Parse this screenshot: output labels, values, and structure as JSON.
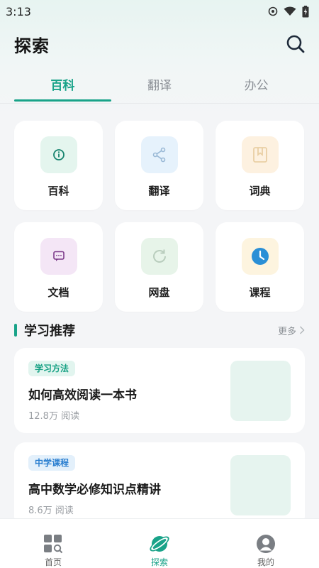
{
  "status_bar": {
    "time": "3:13",
    "icons": [
      "settings-gear-icon",
      "wifi-icon",
      "battery-charging-icon"
    ]
  },
  "header": {
    "title": "探索",
    "search_icon": "search-icon"
  },
  "tabs": [
    {
      "label": "百科",
      "active": true
    },
    {
      "label": "翻译",
      "active": false
    },
    {
      "label": "办公",
      "active": false
    }
  ],
  "grid": [
    {
      "label": "百科",
      "icon": "info-icon",
      "bg": "#e4f5ee",
      "color": "#16836e"
    },
    {
      "label": "翻译",
      "icon": "share-icon",
      "bg": "#e6f2fc",
      "color": "#9ab9d6"
    },
    {
      "label": "词典",
      "icon": "bookmark-icon",
      "bg": "#fdf1e0",
      "color": "#e9cfa4"
    },
    {
      "label": "文档",
      "icon": "chat-bubble-icon",
      "bg": "#f4e6f6",
      "color": "#7d3a8a"
    },
    {
      "label": "网盘",
      "icon": "refresh-icon",
      "bg": "#e7f4e9",
      "color": "#b9cdbd"
    },
    {
      "label": "课程",
      "icon": "clock-icon",
      "bg": "#fdf4df",
      "color": "#2a8fd6"
    }
  ],
  "section": {
    "title": "学习推荐",
    "more": "更多"
  },
  "articles": [
    {
      "tag": "学习方法",
      "title": "如何高效阅读一本书",
      "meta": "12.8万 阅读"
    },
    {
      "tag": "中学课程",
      "title": "高中数学必修知识点精讲",
      "meta": "8.6万 阅读"
    }
  ],
  "bottom_nav": [
    {
      "label": "首页",
      "icon": "home-grid-icon",
      "active": false
    },
    {
      "label": "探索",
      "icon": "planet-icon",
      "active": true
    },
    {
      "label": "我的",
      "icon": "avatar-icon",
      "active": false
    }
  ],
  "colors": {
    "accent": "#19a389",
    "background": "#f4f5f7"
  }
}
